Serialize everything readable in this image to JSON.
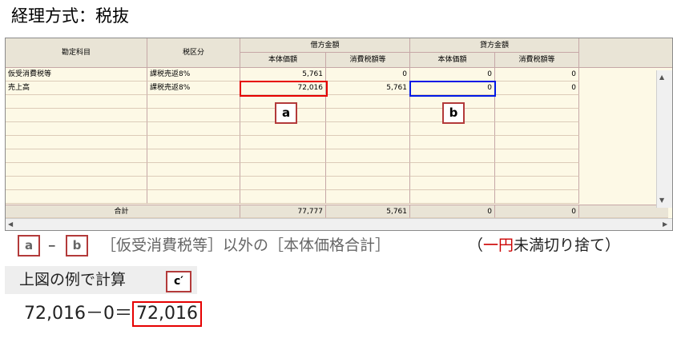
{
  "title": "経理方式：税抜",
  "table": {
    "headers": {
      "account": "勘定科目",
      "tax_class": "税区分",
      "debit": "借方金額",
      "credit": "貸方金額",
      "base_price": "本体価額",
      "tax_amount": "消費税額等"
    },
    "rows": [
      {
        "account": "仮受消費税等",
        "tax_class": "課税売返8%",
        "debit_base": "5,761",
        "debit_tax": "0",
        "credit_base": "0",
        "credit_tax": "0"
      },
      {
        "account": "売上高",
        "tax_class": "課税売返8%",
        "debit_base": "72,016",
        "debit_tax": "5,761",
        "credit_base": "0",
        "credit_tax": "0"
      }
    ],
    "total": {
      "label": "合計",
      "debit_base": "77,777",
      "debit_tax": "5,761",
      "credit_base": "0",
      "credit_tax": "0"
    }
  },
  "markers": {
    "a": "a",
    "b": "b",
    "c": "c′"
  },
  "formula": {
    "dash": "–",
    "description": "［仮受消費税等］以外の［本体価格合計］",
    "paren_open": "（",
    "red_part": "一円",
    "rest": "未満切り捨て）"
  },
  "calc_label": "上図の例で計算",
  "calc": {
    "lhs": "72,016－0＝",
    "result": "72,016"
  },
  "colors": {
    "highlight_red": "#e60000",
    "highlight_blue": "#0019e6",
    "tag_border": "#b33a3a",
    "grid_bg": "#fdf9e6"
  }
}
